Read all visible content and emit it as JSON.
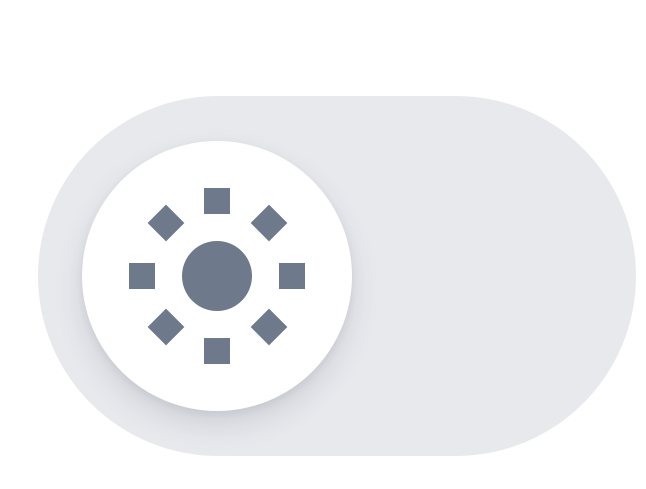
{
  "theme_toggle": {
    "state": "light",
    "checked": false,
    "icon": "sun-icon",
    "colors": {
      "track": "#e8e9ed",
      "knob": "#ffffff",
      "icon": "#6f798c"
    }
  }
}
